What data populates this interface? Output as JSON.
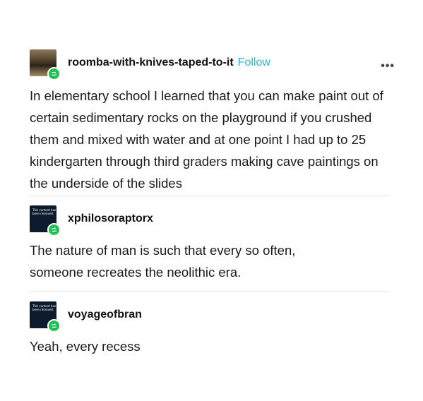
{
  "posts": [
    {
      "username": "roomba-with-knives-taped-to-it",
      "follow_label": "Follow",
      "more_label": "•••",
      "avatar": "roomba-photo",
      "text": "In elementary school I learned that you can make paint out of certain sedimentary rocks on the playground if you crushed them and mixed with water and at one point I had up to 25 kindergarten through third graders making cave paintings on the underside of the slides"
    },
    {
      "username": "xphilosoraptorx",
      "avatar_text": "This content has been removed.",
      "text": "The nature of man is such that every so often, someone recreates the neolithic era."
    },
    {
      "username": "voyageofbran",
      "avatar_text": "This content has been removed.",
      "text": "Yeah, every recess"
    }
  ],
  "colors": {
    "follow": "#2fb6c9",
    "reblog_badge": "#1fbf56",
    "removed_avatar": "#0d1b2e"
  },
  "icons": {
    "reblog_badge": "reblog-icon",
    "more": "ellipsis-icon"
  }
}
